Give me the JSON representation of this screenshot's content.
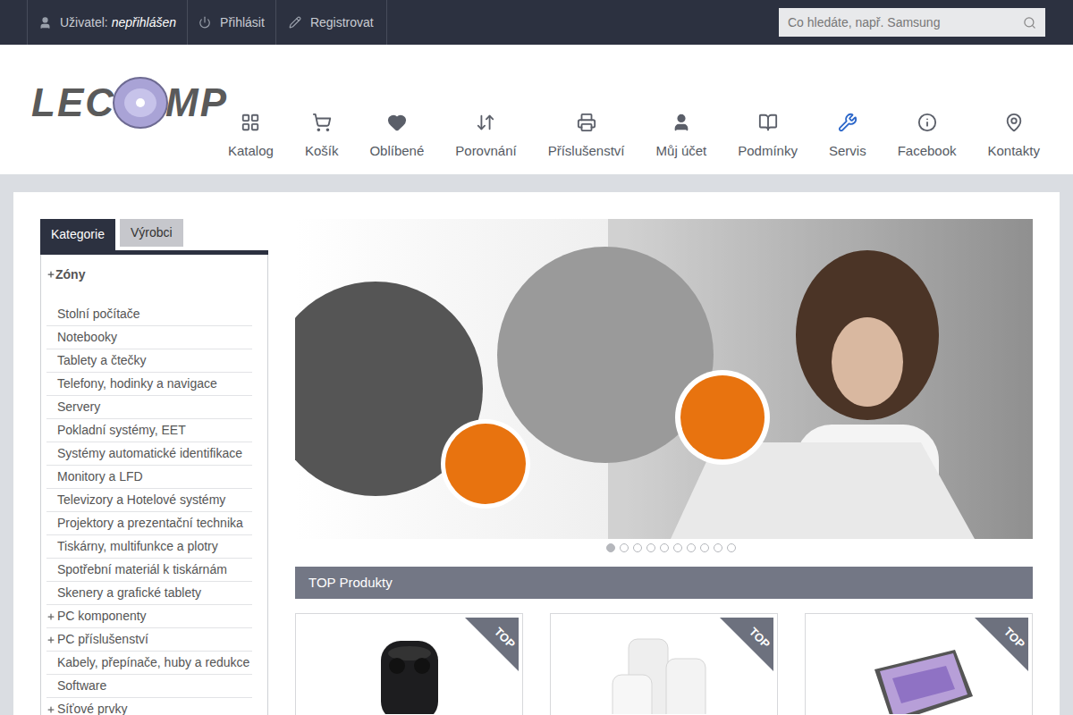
{
  "topbar": {
    "user_label": "Uživatel:",
    "user_value": "nepřihlášen",
    "login": "Přihlásit",
    "register": "Registrovat",
    "search_placeholder": "Co hledáte, např. Samsung"
  },
  "logo": {
    "left": "LEC",
    "right": "MP"
  },
  "nav": [
    {
      "label": "Katalog",
      "highlighted": false
    },
    {
      "label": "Košík",
      "highlighted": false
    },
    {
      "label": "Oblíbené",
      "highlighted": false
    },
    {
      "label": "Porovnání",
      "highlighted": false
    },
    {
      "label": "Příslušenství",
      "highlighted": false
    },
    {
      "label": "Můj účet",
      "highlighted": false
    },
    {
      "label": "Podmínky",
      "highlighted": false
    },
    {
      "label": "Servis",
      "highlighted": true
    },
    {
      "label": "Facebook",
      "highlighted": false
    },
    {
      "label": "Kontakty",
      "highlighted": false
    }
  ],
  "sidebar": {
    "tabs": [
      {
        "label": "Kategorie",
        "selected": true
      },
      {
        "label": "Výrobci",
        "selected": false
      }
    ],
    "zone": {
      "label": "Zóny",
      "expandable": true
    },
    "items": [
      {
        "label": "Stolní počítače",
        "expandable": false
      },
      {
        "label": "Notebooky",
        "expandable": false
      },
      {
        "label": "Tablety a čtečky",
        "expandable": false
      },
      {
        "label": "Telefony, hodinky a navigace",
        "expandable": false
      },
      {
        "label": "Servery",
        "expandable": false
      },
      {
        "label": "Pokladní systémy, EET",
        "expandable": false
      },
      {
        "label": "Systémy automatické identifikace",
        "expandable": false
      },
      {
        "label": "Monitory a LFD",
        "expandable": false
      },
      {
        "label": "Televizory a Hotelové systémy",
        "expandable": false
      },
      {
        "label": "Projektory a prezentační technika",
        "expandable": false
      },
      {
        "label": "Tiskárny, multifunkce a plotry",
        "expandable": false
      },
      {
        "label": "Spotřební materiál k tiskárnám",
        "expandable": false
      },
      {
        "label": "Skenery a grafické tablety",
        "expandable": false
      },
      {
        "label": "PC komponenty",
        "expandable": true
      },
      {
        "label": "PC příslušenství",
        "expandable": true
      },
      {
        "label": "Kabely, přepínače, huby a redukce",
        "expandable": false
      },
      {
        "label": "Software",
        "expandable": false
      },
      {
        "label": "Síťové prvky",
        "expandable": true
      }
    ]
  },
  "banner": {
    "slides": [
      {
        "selected": true
      },
      {
        "selected": false
      },
      {
        "selected": false
      },
      {
        "selected": false
      },
      {
        "selected": false
      },
      {
        "selected": false
      },
      {
        "selected": false
      },
      {
        "selected": false
      },
      {
        "selected": false
      },
      {
        "selected": false
      }
    ]
  },
  "top_products": {
    "title": "TOP Produkty",
    "items": [
      {
        "badge": "TOP",
        "kind": "earbuds"
      },
      {
        "badge": "TOP",
        "kind": "mesh"
      },
      {
        "badge": "TOP",
        "kind": "tablet"
      }
    ]
  }
}
